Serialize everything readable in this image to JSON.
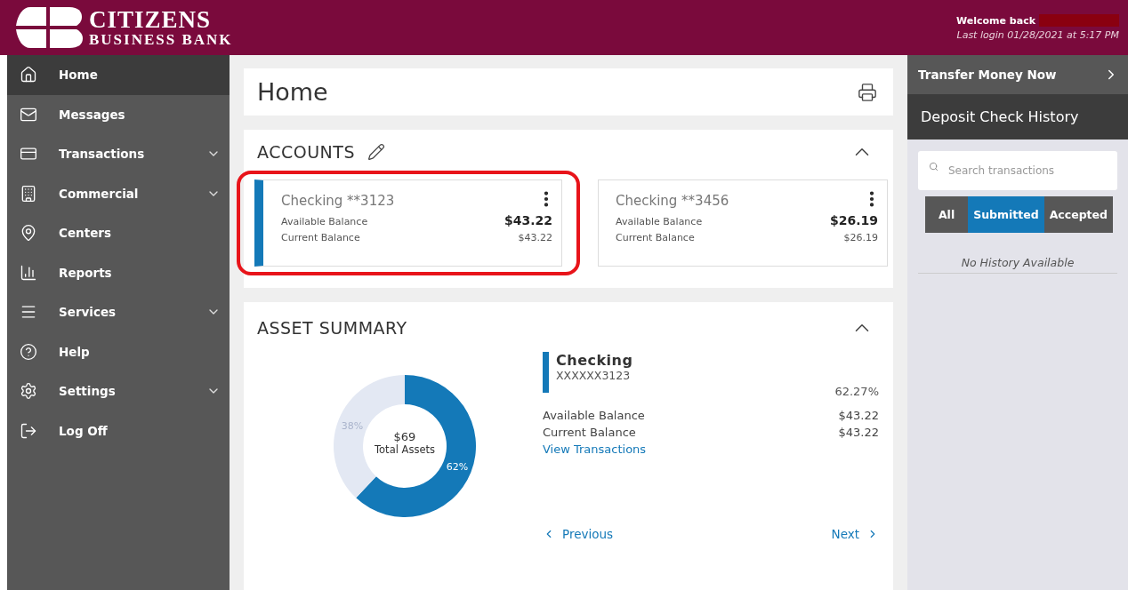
{
  "header": {
    "logo_line_1": "CITIZENS",
    "logo_line_2": "BUSINESS BANK",
    "welcome": "Welcome back",
    "name_redacted": true,
    "last_login": "Last login 01/28/2021 at 5:17 PM"
  },
  "sidebar": {
    "items": [
      {
        "label": "Home",
        "selected": true,
        "expandable": false
      },
      {
        "label": "Messages",
        "selected": false,
        "expandable": false
      },
      {
        "label": "Transactions",
        "selected": false,
        "expandable": true
      },
      {
        "label": "Commercial",
        "selected": false,
        "expandable": true
      },
      {
        "label": "Centers",
        "selected": false,
        "expandable": false
      },
      {
        "label": "Reports",
        "selected": false,
        "expandable": false
      },
      {
        "label": "Services",
        "selected": false,
        "expandable": true
      },
      {
        "label": "Help",
        "selected": false,
        "expandable": false
      },
      {
        "label": "Settings",
        "selected": false,
        "expandable": true
      },
      {
        "label": "Log Off",
        "selected": false,
        "expandable": false
      }
    ]
  },
  "page": {
    "title": "Home"
  },
  "accounts": {
    "title": "ACCOUNTS",
    "expanded": true,
    "items": [
      {
        "name": "Checking **3123",
        "available_label": "Available Balance",
        "available": "$43.22",
        "current_label": "Current Balance",
        "current": "$43.22",
        "selected": true,
        "highlighted": true
      },
      {
        "name": "Checking **3456",
        "available_label": "Available Balance",
        "available": "$26.19",
        "current_label": "Current Balance",
        "current": "$26.19",
        "selected": false,
        "highlighted": false
      }
    ]
  },
  "asset_summary": {
    "title": "ASSET SUMMARY",
    "expanded": true,
    "chart_data": {
      "type": "donut",
      "values": [
        62,
        38
      ],
      "value_labels": [
        "62%",
        "38%"
      ]
    },
    "center_value": "$69",
    "center_label": "Total Assets",
    "detail": {
      "name": "Checking",
      "number": "XXXXXX3123",
      "share": "62.27%",
      "available_label": "Available Balance",
      "available": "$43.22",
      "current_label": "Current Balance",
      "current": "$43.22",
      "link": "View Transactions"
    },
    "previous": "Previous",
    "next": "Next"
  },
  "right_panel": {
    "transfer": "Transfer Money Now",
    "deposit_title": "Deposit Check History",
    "search": {
      "placeholder": "Search transactions"
    },
    "filters": [
      {
        "label": "All",
        "selected": false
      },
      {
        "label": "Submitted",
        "selected": true
      },
      {
        "label": "Accepted",
        "selected": false
      }
    ],
    "empty": "No History Available"
  }
}
